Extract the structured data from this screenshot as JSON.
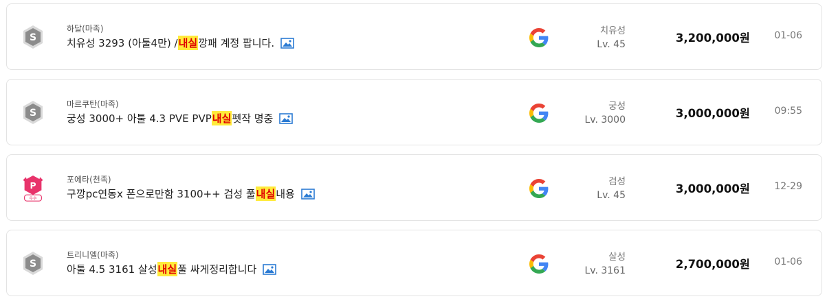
{
  "listings": [
    {
      "server": "하달(마족)",
      "title_before": "치유성 3293 (아툴4만) / ",
      "title_highlight": "내실",
      "title_after": "깡패 계정 팝니다.",
      "class": "치유성",
      "level": "Lv. 45",
      "price": "3,200,000원",
      "date": "01-06",
      "badge": "s-badge-icon"
    },
    {
      "server": "마르쿠탄(마족)",
      "title_before": "궁성 3000+ 아툴 4.3 PVE PVP ",
      "title_highlight": "내실",
      "title_after": " 펫작 명중",
      "class": "궁성",
      "level": "Lv. 3000",
      "price": "3,000,000원",
      "date": "09:55",
      "badge": "s-badge-icon"
    },
    {
      "server": "포에타(천족)",
      "title_before": "구깡pc연동x 폰으로만함 3100++ 검성 풀",
      "title_highlight": "내실",
      "title_after": " 내용",
      "class": "검성",
      "level": "Lv. 45",
      "price": "3,000,000원",
      "date": "12-29",
      "badge": "premium-seller-icon",
      "badge_text": "우수"
    },
    {
      "server": "트리니엘(마족)",
      "title_before": "아툴 4.5 3161 살성 ",
      "title_highlight": "내실",
      "title_after": "풀 싸게정리합니다",
      "class": "살성",
      "level": "Lv. 3161",
      "price": "2,700,000원",
      "date": "01-06",
      "badge": "s-badge-icon"
    }
  ],
  "colors": {
    "highlight_bg": "#ffeb3b",
    "highlight_text": "#e00000",
    "badge_gray": "#8c8c8c",
    "badge_pink": "#e8336b"
  }
}
